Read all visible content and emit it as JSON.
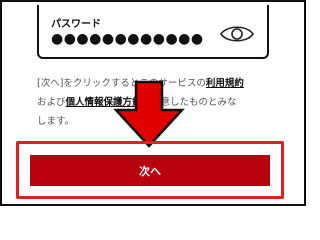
{
  "password_field": {
    "label": "パスワード",
    "value": "●●●●●●●●●●●●",
    "toggle_icon": "eye-icon"
  },
  "terms": {
    "line1_prefix": "[次へ]をクリックするとこのサービスの",
    "terms_link": "利用規約",
    "line2_prefix": "および",
    "privacy_link": "個人情報保護方針",
    "line2_suffix": "に同意したものとみな",
    "line3": "します。"
  },
  "annotation": {
    "arrow_icon": "down-arrow-icon",
    "arrow_color": "#e00000",
    "highlight_color": "#e02020"
  },
  "next_button": {
    "label": "次へ",
    "color": "#b8000e"
  }
}
